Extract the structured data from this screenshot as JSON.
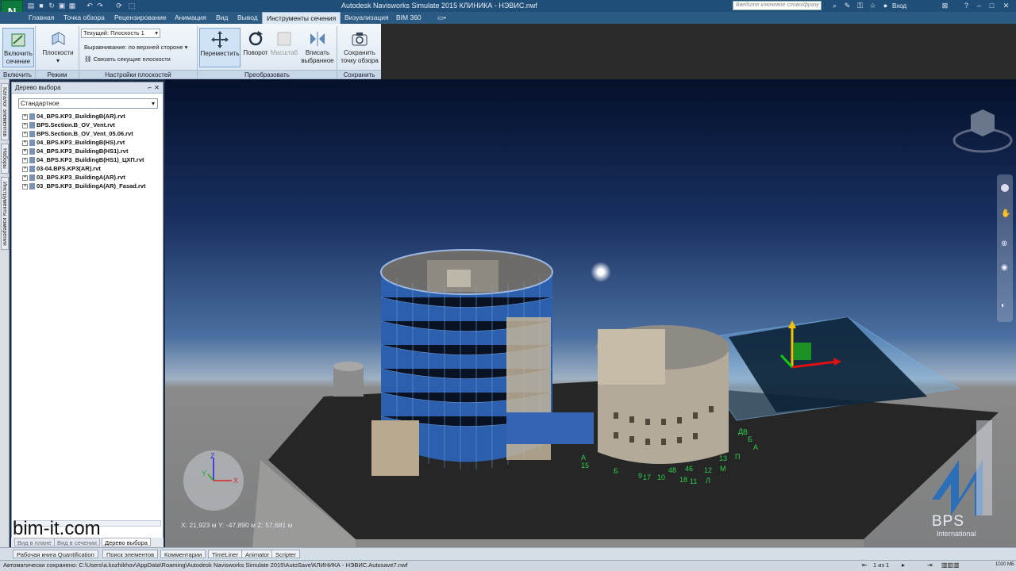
{
  "app": {
    "title": "Autodesk Navisworks Simulate 2015   КЛИНИКА - НЭВИС.nwf",
    "logo_letter": "N",
    "search_placeholder": "Введите ключевое слово/фразу",
    "user": "Вход"
  },
  "tabs": [
    "Главная",
    "Точка обзора",
    "Рецензирование",
    "Анимация",
    "Вид",
    "Вывод",
    "Инструменты сечения",
    "Визуализация",
    "BIM 360"
  ],
  "active_tab": "Инструменты сечения",
  "ribbon": {
    "enable": {
      "label": "Включить сечение",
      "panel": "Включить"
    },
    "mode": {
      "label": "Плоскости",
      "panel": "Режим"
    },
    "plane_settings": {
      "current": "Текущий: Плоскость 1",
      "align": "Выравнивание: по верхней стороне",
      "link": "Связать секущие плоскости",
      "panel": "Настройки плоскостей"
    },
    "transform": {
      "move": "Переместить",
      "rotate": "Поворот",
      "scale": "Масштаб",
      "fit": "Вписать выбранное",
      "panel": "Преобразовать"
    },
    "save": {
      "label": "Сохранить точку обзора",
      "panel": "Сохранить"
    }
  },
  "left_strip": [
    "Каталог элементов",
    "Наборы",
    "Инструменты измерения"
  ],
  "selection_tree": {
    "title": "Дерево выбора",
    "mode": "Стандартное",
    "items": [
      "04_BPS.KP3_BuildingB(AR).rvt",
      "BPS.Section.B_OV_Vent.rvt",
      "BPS.Section.B_OV_Vent_05.06.rvt",
      "04_BPS.KP3_BuildingB(HS).rvt",
      "04_BPS.KP3_BuildingB(HS1).rvt",
      "04_BPS.KP3_BuildingB(HS1)_ЦХП.rvt",
      "03-04.BPS.KP3(AR).rvt",
      "03_BPS.KP3_BuildingA(AR).rvt",
      "03_BPS.KP3_BuildingA(AR)_Fasad.rvt"
    ],
    "bottom_tabs": [
      "Вид в плане",
      "Вид в сечении",
      "Дерево выбора"
    ]
  },
  "viewport": {
    "coords": "X: 21,923 м  Y: -47,890 м  Z: 57,681 м",
    "watermark": "bim-it.com",
    "brand": "BPS",
    "brand_sub": "International",
    "grid_labels": [
      "15",
      "А",
      "Б",
      "9",
      "17",
      "10",
      "48",
      "18",
      "11",
      "12",
      "Л",
      "13",
      "М",
      "П",
      "Д",
      "В",
      "Б",
      "А",
      "46"
    ]
  },
  "bottom_tabs": [
    "Рабочая книга Quantification",
    "Поиск элементов",
    "Комментарии",
    "TimeLiner",
    "Animator",
    "Scripter"
  ],
  "status": {
    "text": "Автоматически сохранено: C:\\Users\\a.kozhikhov\\AppData\\Roaming\\Autodesk Navisworks Simulate 2015\\AutoSave\\КЛИНИКА - НЭВИС.Autosave7.nwf",
    "pages": "1 из 1",
    "mem": "1020 МБ"
  }
}
